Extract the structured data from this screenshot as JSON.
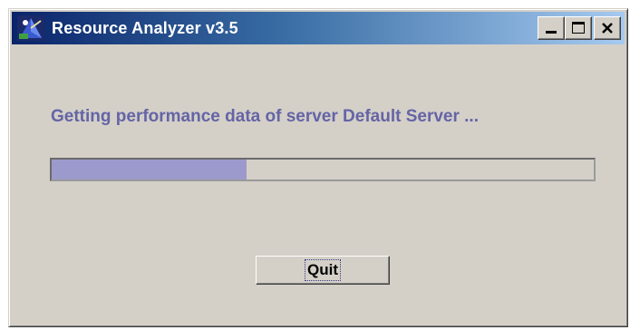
{
  "window": {
    "title": "Resource Analyzer v3.5",
    "icon": "app-icon",
    "controls": [
      "minimize-icon",
      "maximize-icon",
      "close-icon"
    ]
  },
  "status": {
    "message": "Getting performance data of server Default Server ..."
  },
  "progress": {
    "value_fraction": 0.36,
    "fill_color": "#9c9acc"
  },
  "buttons": {
    "quit_label": "Quit"
  },
  "colors": {
    "title_gradient_start": "#0a246a",
    "title_gradient_end": "#a6caf0",
    "window_bg": "#d4d0c8",
    "status_text": "#6464a6"
  }
}
